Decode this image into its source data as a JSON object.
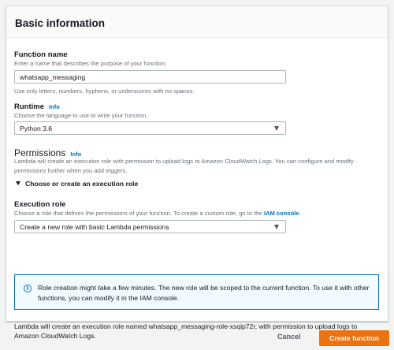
{
  "panel": {
    "title": "Basic information"
  },
  "function_name": {
    "label": "Function name",
    "description": "Enter a name that describes the purpose of your function.",
    "value": "whatsapp_messaging",
    "hint": "Use only letters, numbers, hyphens, or underscores with no spaces."
  },
  "runtime": {
    "label": "Runtime",
    "info": "Info",
    "description": "Choose the language to use to write your function.",
    "selected": "Python 3.6"
  },
  "permissions": {
    "title": "Permissions",
    "info": "Info",
    "description": "Lambda will create an execution role with permission to upload logs to Amazon CloudWatch Logs. You can configure and modify permissions further when you add triggers.",
    "expander_label": "Choose or create an execution role"
  },
  "execution_role": {
    "label": "Execution role",
    "description_prefix": "Choose a role that defines the permissions of your function. To create a custom role, go to the",
    "iam_link": "IAM console",
    "description_suffix": ".",
    "selected": "Create a new role with basic Lambda permissions"
  },
  "alert": {
    "icon": "info-icon",
    "text": "Role creation might take a few minutes. The new role will be scoped to the current function. To use it with other functions, you can modify it in the IAM console."
  },
  "footer_note": "Lambda will create an execution role named whatsapp_messaging-role-xsqip72r, with permission to upload logs to Amazon CloudWatch Logs.",
  "actions": {
    "cancel": "Cancel",
    "create": "Create function"
  },
  "colors": {
    "primary_button": "#ec7211",
    "link": "#0073bb",
    "alert_background": "#f1faff"
  }
}
